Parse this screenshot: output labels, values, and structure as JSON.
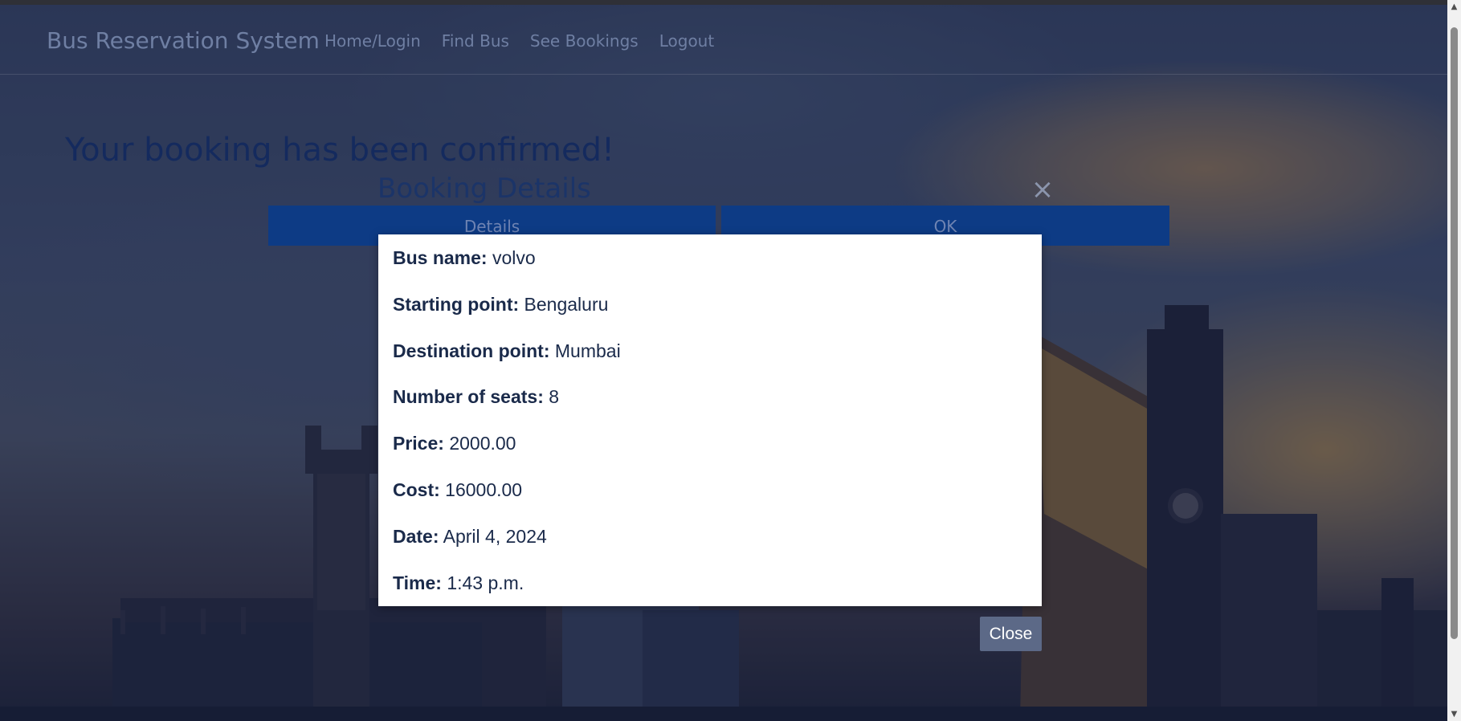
{
  "navbar": {
    "brand": "Bus Reservation System",
    "links": [
      "Home/Login",
      "Find Bus",
      "See Bookings",
      "Logout"
    ]
  },
  "page": {
    "heading": "Your booking has been confirmed!"
  },
  "modal": {
    "title": "Booking Details",
    "close_glyph": "×",
    "columns": [
      "Details",
      "OK"
    ]
  },
  "details": {
    "bus_name": {
      "label": "Bus name:",
      "value": "volvo"
    },
    "start": {
      "label": "Starting point:",
      "value": "Bengaluru"
    },
    "destination": {
      "label": "Destination point:",
      "value": "Mumbai"
    },
    "seats": {
      "label": "Number of seats:",
      "value": "8"
    },
    "price": {
      "label": "Price:",
      "value": "2000.00"
    },
    "cost": {
      "label": "Cost:",
      "value": "16000.00"
    },
    "date": {
      "label": "Date:",
      "value": "April 4, 2024"
    },
    "time": {
      "label": "Time:",
      "value": "1:43 p.m."
    }
  },
  "close_button": "Close",
  "colors": {
    "overlay": "#0e1e4a",
    "column_button": "#0d3b85",
    "close_button": "#5c6987"
  }
}
